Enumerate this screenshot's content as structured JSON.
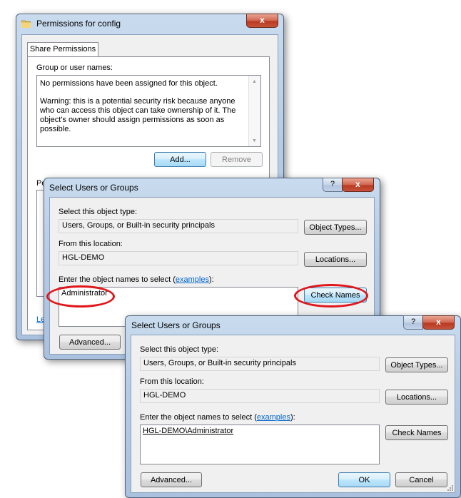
{
  "permissions_window": {
    "title": "Permissions for config",
    "close_glyph": "x",
    "tab_label": "Share Permissions",
    "group_label": "Group or user names:",
    "message_line1": "No permissions have been assigned for this object.",
    "message_warning": "Warning: this is a potential security risk because anyone who can access this object can take ownership of it. The object's owner should assign permissions as soon as possible.",
    "add_label": "Add...",
    "remove_label": "Remove",
    "perm_label_partial": "Pe",
    "link_partial": "Le"
  },
  "dialog1": {
    "title": "Select Users or Groups",
    "help_glyph": "?",
    "close_glyph": "x",
    "object_type_label": "Select this object type:",
    "object_type_value": "Users, Groups, or Built-in security principals",
    "object_types_button": "Object Types...",
    "location_label": "From this location:",
    "location_value": "HGL-DEMO",
    "locations_button": "Locations...",
    "names_label": "Enter the object names to select (",
    "names_label_link": "examples",
    "names_label_end": "):",
    "names_value": "Administrator",
    "check_names_button": "Check Names",
    "advanced_button": "Advanced..."
  },
  "dialog2": {
    "title": "Select Users or Groups",
    "help_glyph": "?",
    "close_glyph": "x",
    "object_type_label": "Select this object type:",
    "object_type_value": "Users, Groups, or Built-in security principals",
    "object_types_button": "Object Types...",
    "location_label": "From this location:",
    "location_value": "HGL-DEMO",
    "locations_button": "Locations...",
    "names_label": "Enter the object names to select (",
    "names_label_link": "examples",
    "names_label_end": "):",
    "names_value": "HGL-DEMO\\Administrator",
    "check_names_button": "Check Names",
    "advanced_button": "Advanced...",
    "ok_button": "OK",
    "cancel_button": "Cancel"
  },
  "colors": {
    "highlight_ellipse": "#e0161b",
    "link": "#0066cc"
  }
}
